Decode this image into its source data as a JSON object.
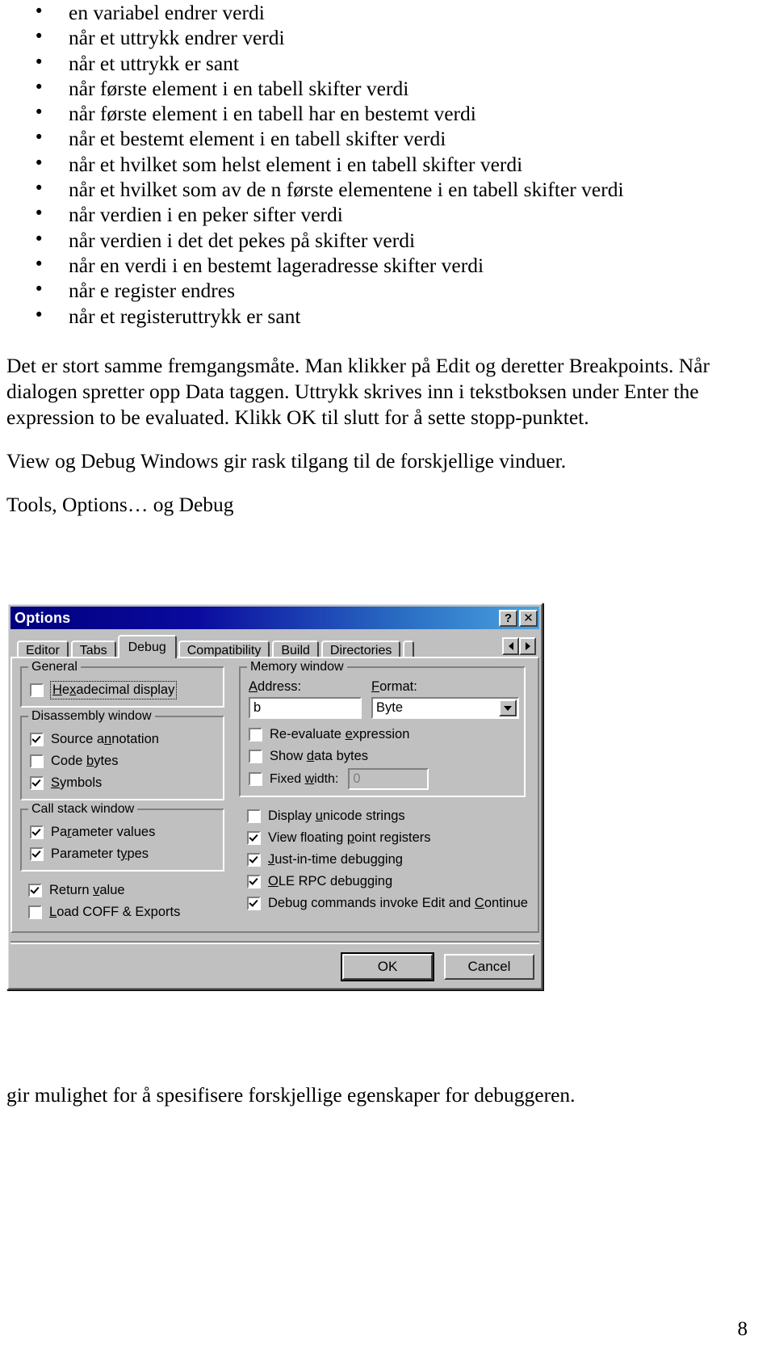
{
  "document": {
    "bullets": [
      "en variabel endrer verdi",
      "når et uttrykk endrer verdi",
      "når et uttrykk er sant",
      "når første element i en tabell skifter verdi",
      "når første element i en tabell har en bestemt verdi",
      "når et bestemt element i en tabell skifter verdi",
      "når et hvilket som helst element i en tabell skifter verdi",
      "når et hvilket som av de n første elementene i en tabell skifter verdi",
      "når verdien i en peker sifter verdi",
      "når verdien i det det pekes på skifter verdi",
      "når en verdi i en bestemt lageradresse skifter verdi",
      "når e register endres",
      "når et registeruttrykk er sant"
    ],
    "paragraph_1": "Det er stort samme fremgangsmåte. Man klikker på Edit og deretter Breakpoints. Når dialogen spretter opp Data taggen. Uttrykk skrives inn i tekstboksen under Enter the expression  to be evaluated. Klikk OK til slutt for å sette stopp-punktet.",
    "paragraph_2": "View og Debug Windows gir rask tilgang til de forskjellige vinduer.",
    "paragraph_3": "Tools, Options… og Debug",
    "caption_bottom": "gir mulighet for å spesifisere forskjellige egenskaper for debuggeren.",
    "page_number": "8"
  },
  "dialog": {
    "title": "Options",
    "title_buttons": {
      "help": "?",
      "close": "✕"
    },
    "tabs": [
      {
        "label": "Editor",
        "selected": false
      },
      {
        "label": "Tabs",
        "selected": false
      },
      {
        "label": "Debug",
        "selected": true
      },
      {
        "label": "Compatibility",
        "selected": false
      },
      {
        "label": "Build",
        "selected": false
      },
      {
        "label": "Directories",
        "selected": false
      }
    ],
    "tab_scroll": {
      "left": "◀",
      "right": "▶"
    },
    "general": {
      "title": "General",
      "hexadecimal_display": {
        "label": "Hexadecimal display",
        "checked": false,
        "focused": true
      }
    },
    "disassembly_window": {
      "title": "Disassembly window",
      "items": [
        {
          "label": "Source annotation",
          "checked": true
        },
        {
          "label": "Code bytes",
          "checked": false
        },
        {
          "label": "Symbols",
          "checked": true
        }
      ]
    },
    "call_stack_window": {
      "title": "Call stack window",
      "items": [
        {
          "label": "Parameter values",
          "checked": true
        },
        {
          "label": "Parameter types",
          "checked": true
        }
      ]
    },
    "left_loose_items": [
      {
        "label": "Return value",
        "checked": true
      },
      {
        "label": "Load COFF & Exports",
        "checked": false
      }
    ],
    "memory_window": {
      "title": "Memory window",
      "address_label": "Address:",
      "address_value": "b",
      "format_label": "Format:",
      "format_value": "Byte",
      "items": [
        {
          "label": "Re-evaluate expression",
          "checked": false
        },
        {
          "label": "Show data bytes",
          "checked": false
        }
      ],
      "fixed_width": {
        "label": "Fixed width:",
        "checked": false,
        "value": "0"
      }
    },
    "right_loose_items": [
      {
        "label": "Display unicode strings",
        "checked": false
      },
      {
        "label": "View floating point registers",
        "checked": true
      },
      {
        "label": "Just-in-time debugging",
        "checked": true
      },
      {
        "label": "OLE RPC debugging",
        "checked": true
      },
      {
        "label": "Debug commands invoke Edit and Continue",
        "checked": true
      }
    ],
    "buttons": {
      "ok": "OK",
      "cancel": "Cancel"
    }
  }
}
